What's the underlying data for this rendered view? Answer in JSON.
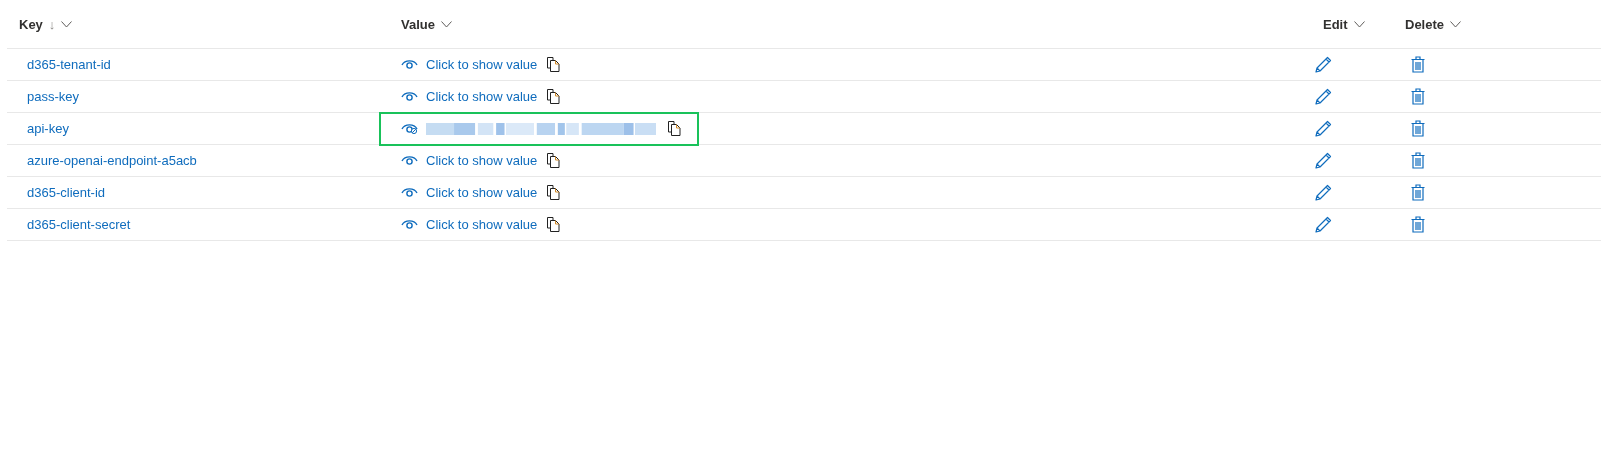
{
  "columns": [
    {
      "label": "Key",
      "sort_indicator": "↓"
    },
    {
      "label": "Value"
    },
    {
      "label": "Edit"
    },
    {
      "label": "Delete"
    }
  ],
  "rows": [
    {
      "key": "d365-tenant-id",
      "value_link": "Click to show value",
      "revealed": false
    },
    {
      "key": "pass-key",
      "value_link": "Click to show value",
      "revealed": false
    },
    {
      "key": "api-key",
      "revealed": true
    },
    {
      "key": "azure-openai-endpoint-a5acb",
      "value_link": "Click to show value",
      "revealed": false
    },
    {
      "key": "d365-client-id",
      "value_link": "Click to show value",
      "revealed": false
    },
    {
      "key": "d365-client-secret",
      "value_link": "Click to show value",
      "revealed": false
    }
  ]
}
